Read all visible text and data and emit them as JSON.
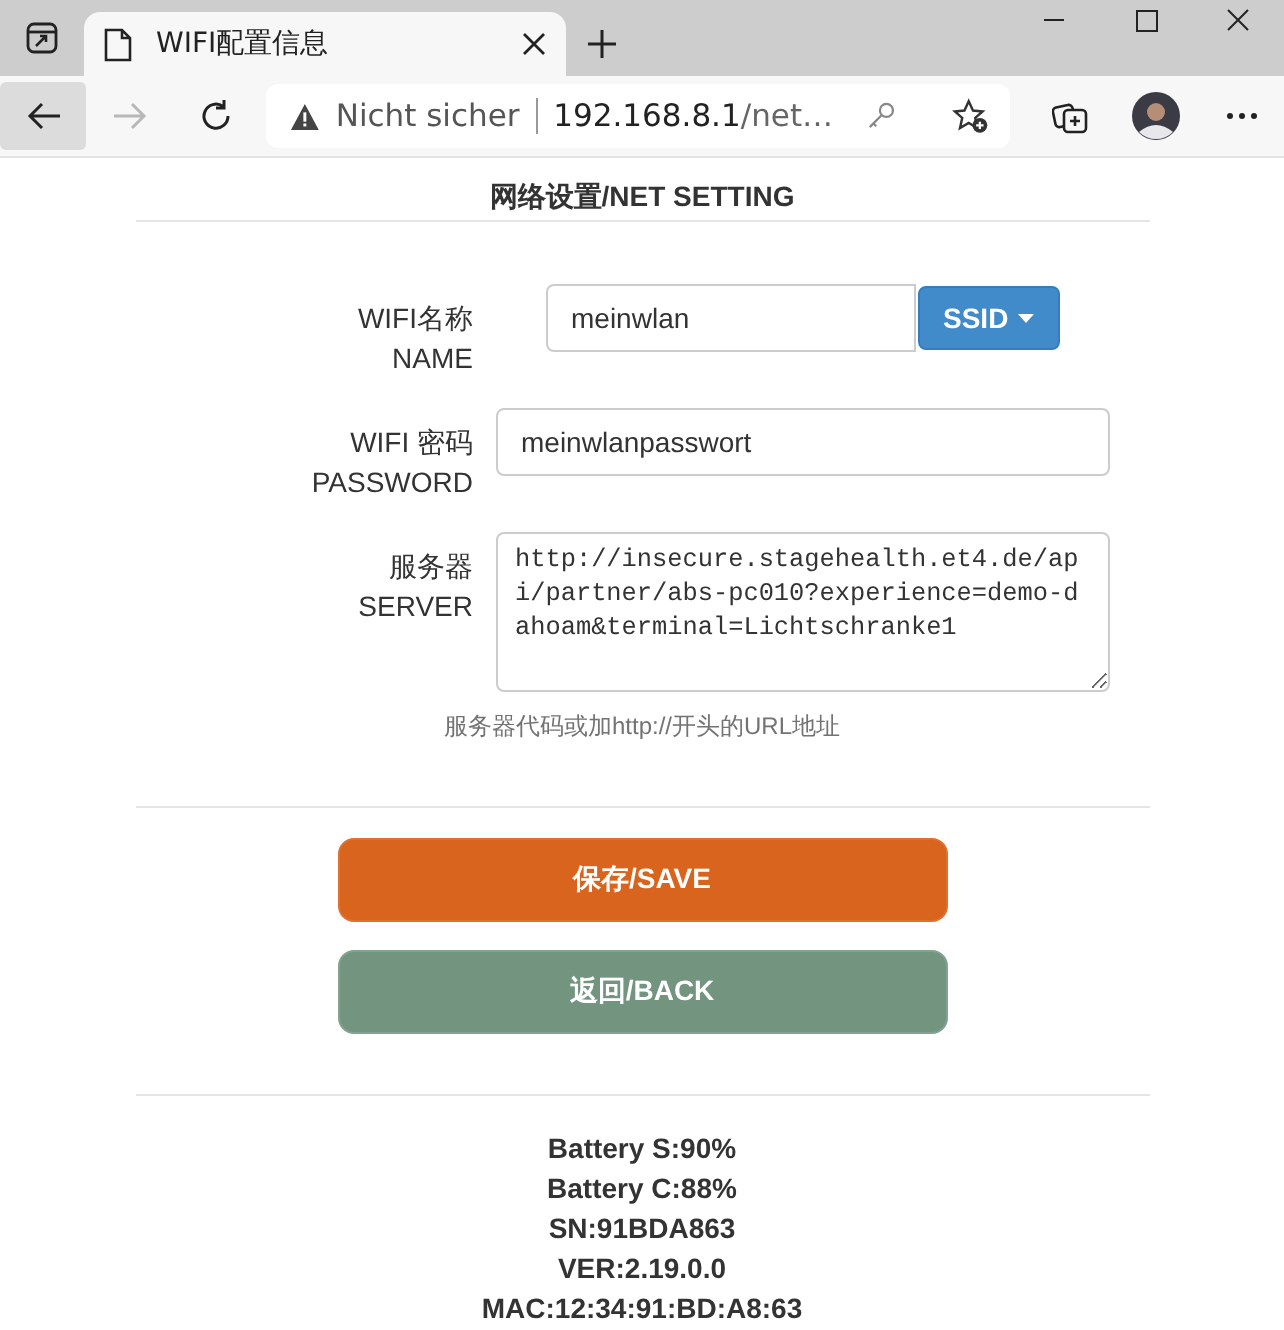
{
  "browser": {
    "tab_title": "WIFI配置信息",
    "nav": {
      "back": {
        "disabled": false
      },
      "forward": {
        "disabled": true
      }
    },
    "security_label": "Nicht sicher",
    "url_host": "192.168.8.1",
    "url_rest": "/net…"
  },
  "heading": "网络设置/NET SETTING",
  "fields": [
    {
      "kind": "input-with-button",
      "label_lines": [
        "WIFI名称",
        "NAME"
      ],
      "value": "meinwlan",
      "button": "SSID"
    },
    {
      "kind": "input",
      "label_lines": [
        "WIFI 密码",
        "PASSWORD"
      ],
      "value": "meinwlanpasswort"
    },
    {
      "kind": "textarea",
      "label_lines": [
        "服务器",
        "SERVER"
      ],
      "value": "http://insecure.stagehealth.et4.de/api/partner/abs-pc010?experience=demo-dahoam&terminal=Lichtschranke1"
    }
  ],
  "help_text": "服务器代码或加http://开头的URL地址",
  "buttons": [
    {
      "kind": "primary",
      "label": "保存/SAVE"
    },
    {
      "kind": "secondary",
      "label": "返回/BACK"
    }
  ],
  "info_lines": [
    "Battery S:90%",
    "Battery C:88%",
    "SN:91BDA863",
    "VER:2.19.0.0",
    "MAC:12:34:91:BD:A8:63"
  ]
}
